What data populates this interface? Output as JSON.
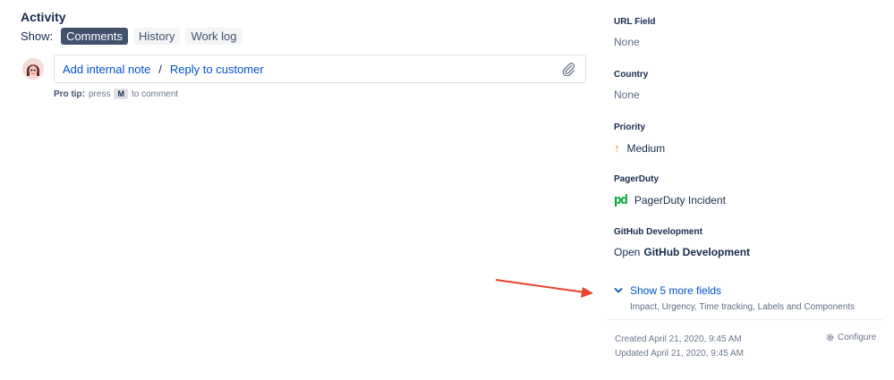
{
  "activity": {
    "heading": "Activity",
    "show_label": "Show:",
    "filters": [
      {
        "label": "Comments",
        "active": true
      },
      {
        "label": "History",
        "active": false
      },
      {
        "label": "Work log",
        "active": false
      }
    ],
    "comment": {
      "internal_note": "Add internal note",
      "separator": "/",
      "reply": "Reply to customer"
    },
    "pro_tip": {
      "label": "Pro tip:",
      "before": "press",
      "key": "M",
      "after": "to comment"
    }
  },
  "sidebar": {
    "fields": [
      {
        "label": "URL Field",
        "value": "None"
      },
      {
        "label": "Country",
        "value": "None"
      },
      {
        "label": "Priority",
        "value": "Medium",
        "icon": "arrow-up-icon"
      },
      {
        "label": "PagerDuty",
        "value": "PagerDuty Incident",
        "icon": "pagerduty-icon",
        "icon_text": "pd"
      },
      {
        "label": "GitHub Development",
        "prefix": "Open",
        "value": "GitHub Development"
      }
    ],
    "more_fields": {
      "link": "Show 5 more fields",
      "description": "Impact, Urgency, Time tracking, Labels and Components"
    },
    "created": "Created April 21, 2020, 9:45 AM",
    "updated": "Updated April 21, 2020, 9:45 AM",
    "configure": "Configure"
  },
  "colors": {
    "link": "#0052cc",
    "active_filter": "#42526e",
    "priority_medium": "#ff8b00",
    "pagerduty": "#06ac38",
    "annotation_arrow": "#e8412c"
  }
}
